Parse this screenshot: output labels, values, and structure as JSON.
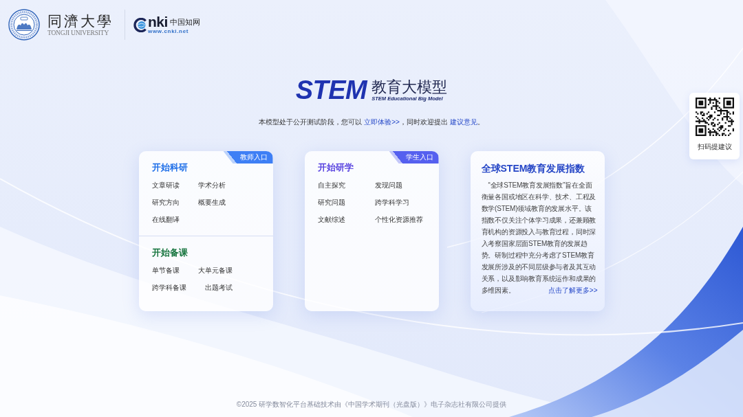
{
  "header": {
    "university": {
      "name": "同濟大學",
      "name_en": "TONGJI UNIVERSITY"
    },
    "partner": {
      "wordmark": "nki",
      "name": "中国知网",
      "url": "www.cnki.net"
    }
  },
  "hero": {
    "title": "STEM",
    "title_cn": "教育大模型",
    "subtitle": "STEM Educational Big Model",
    "notice": [
      {
        "kind": "text",
        "text": "本模型处于公开测试阶段，您可以 "
      },
      {
        "kind": "link",
        "text": "立即体验>>"
      },
      {
        "kind": "text",
        "text": "，同时欢迎提出 "
      },
      {
        "kind": "link",
        "text": "建议意见"
      },
      {
        "kind": "text",
        "text": "。"
      }
    ]
  },
  "cards": [
    {
      "kind": "entry",
      "badge": {
        "text": "教师入口",
        "color": "#3e7ff5"
      },
      "sections": [
        {
          "title": "开始科研",
          "color": "#1f6fe8",
          "items": [
            "文章研读",
            "学术分析",
            "研究方向",
            "概要生成",
            "在线翻译"
          ]
        },
        {
          "title": "开始备课",
          "color": "#17753f",
          "items": [
            "单节备课",
            "大单元备课",
            "跨学科备课",
            "出题考试"
          ]
        }
      ]
    },
    {
      "kind": "entry",
      "badge": {
        "text": "学生入口",
        "color": "#5560ef"
      },
      "sections": [
        {
          "title": "开始研学",
          "color": "#5a45e0",
          "items": [
            "自主探究",
            "发现问题",
            "研究问题",
            "跨学科学习",
            "文献综述",
            "个性化资源推荐"
          ]
        }
      ]
    },
    {
      "kind": "info",
      "title": "全球STEM教育发展指数",
      "text": "“全球STEM教育发展指数”旨在全面衡量各国或地区在科学、技术、工程及数学(STEM)领域教育的发展水平。该指数不仅关注个体学习成果，还兼顾教育机构的资源投入与教育过程，同时深入考察国家层面STEM教育的发展趋势。研制过程中充分考虑了STEM教育发展所涉及的不同层级参与者及其互动关系，以及影响教育系统运作和成果的多维因素。",
      "link": "点击了解更多>>"
    }
  ],
  "qr_widget": {
    "label": "扫码提建议"
  },
  "footer": "©2025 研学数智化平台基础技术由《中国学术期刊（光盘版）》电子杂志社有限公司提供"
}
